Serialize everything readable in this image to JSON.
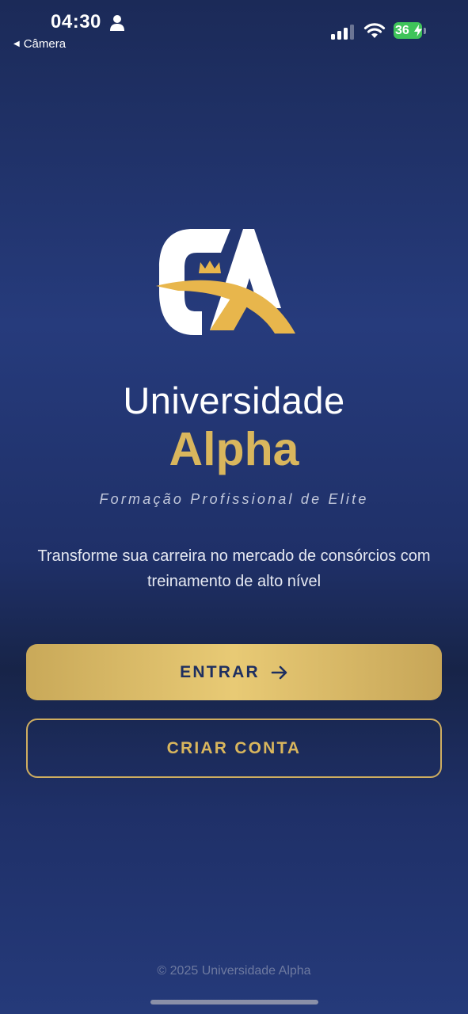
{
  "status_bar": {
    "time": "04:30",
    "back_label": "Câmera",
    "battery_level": "36",
    "battery_color": "#3fc45a",
    "icons": [
      "person-icon",
      "signal-icon",
      "wifi-icon",
      "battery-icon"
    ]
  },
  "brand": {
    "name_line1": "Universidade",
    "name_line2": "Alpha",
    "tagline": "Formação Profissional de Elite",
    "description": "Transforme sua carreira no mercado de consórcios com treinamento de alto nível"
  },
  "actions": {
    "enter_label": "ENTRAR",
    "create_label": "CRIAR CONTA"
  },
  "footer": {
    "copyright": "© 2025 Universidade Alpha"
  },
  "colors": {
    "gold": "#d9b65d",
    "navy": "#1f3068",
    "text_dark": "#1e2f60"
  }
}
